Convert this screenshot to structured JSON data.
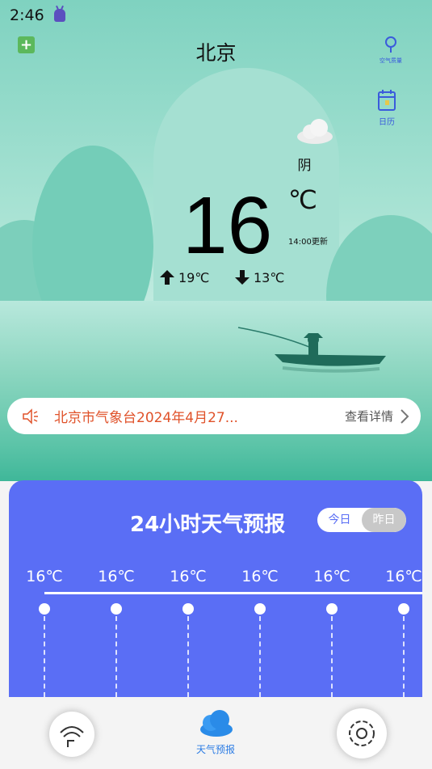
{
  "status_bar": {
    "time": "2:46"
  },
  "header": {
    "city": "北京",
    "air_quality_label": "空气质量",
    "calendar_label": "日历"
  },
  "current": {
    "condition": "阴",
    "temperature": "16",
    "unit": "℃",
    "update_time": "14:00更新",
    "high": "19℃",
    "low": "13℃"
  },
  "notice": {
    "text": "北京市气象台2024年4月27...",
    "more_label": "查看详情"
  },
  "forecast": {
    "title": "24小时天气预报",
    "toggle_today": "今日",
    "toggle_yesterday": "昨日",
    "hourly_temps": [
      "16℃",
      "16℃",
      "16℃",
      "16℃",
      "16℃",
      "16℃"
    ]
  },
  "nav": {
    "center_label": "天气预报"
  },
  "colors": {
    "panel": "#5a6ef5",
    "accent": "#2a7be4",
    "notice_text": "#e0522a"
  }
}
